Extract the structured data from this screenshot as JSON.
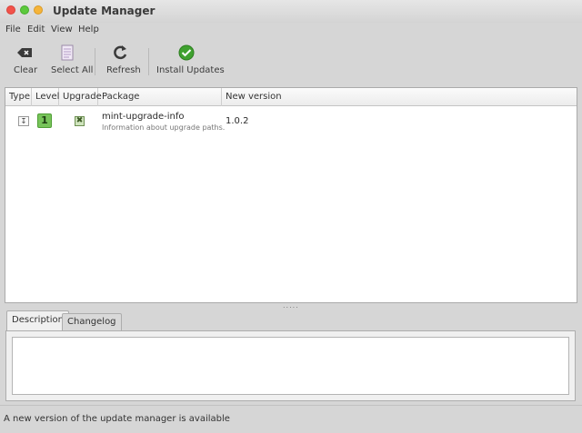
{
  "window": {
    "title": "Update Manager"
  },
  "menu": [
    "File",
    "Edit",
    "View",
    "Help"
  ],
  "toolbar": {
    "clear": "Clear",
    "select_all": "Select All",
    "refresh": "Refresh",
    "install": "Install Updates"
  },
  "table": {
    "headers": [
      "Type",
      "Level",
      "Upgrade",
      "Package",
      "New version"
    ],
    "rows": [
      {
        "level": "1",
        "name": "mint-upgrade-info",
        "description": "Information about upgrade paths.",
        "version": "1.0.2",
        "checked": true
      }
    ]
  },
  "tabs": {
    "description": "Description",
    "changelog": "Changelog"
  },
  "status": "A new version of the update manager is available",
  "colors": {
    "level_1": "#77c45a",
    "install_icon": "#3fa12f"
  }
}
